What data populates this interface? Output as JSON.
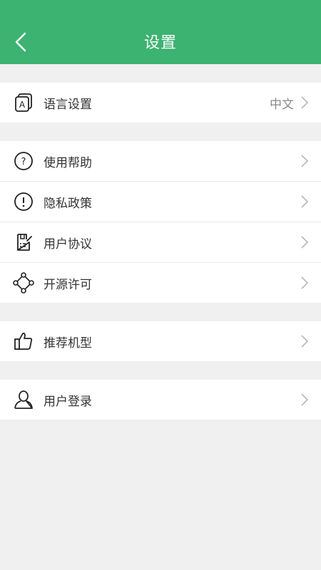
{
  "header": {
    "title": "设置",
    "back_icon": "chevron-left-icon"
  },
  "groups": [
    {
      "items": [
        {
          "label": "语言设置",
          "value": "中文",
          "icon": "language-icon"
        }
      ]
    },
    {
      "items": [
        {
          "label": "使用帮助",
          "icon": "help-icon"
        },
        {
          "label": "隐私政策",
          "icon": "privacy-icon"
        },
        {
          "label": "用户协议",
          "icon": "agreement-icon"
        },
        {
          "label": "开源许可",
          "icon": "open-source-icon"
        }
      ]
    },
    {
      "items": [
        {
          "label": "推荐机型",
          "icon": "thumbs-up-icon"
        }
      ]
    },
    {
      "items": [
        {
          "label": "用户登录",
          "icon": "user-icon"
        }
      ]
    }
  ],
  "colors": {
    "accent": "#3cb371",
    "background": "#f0f0f0"
  }
}
